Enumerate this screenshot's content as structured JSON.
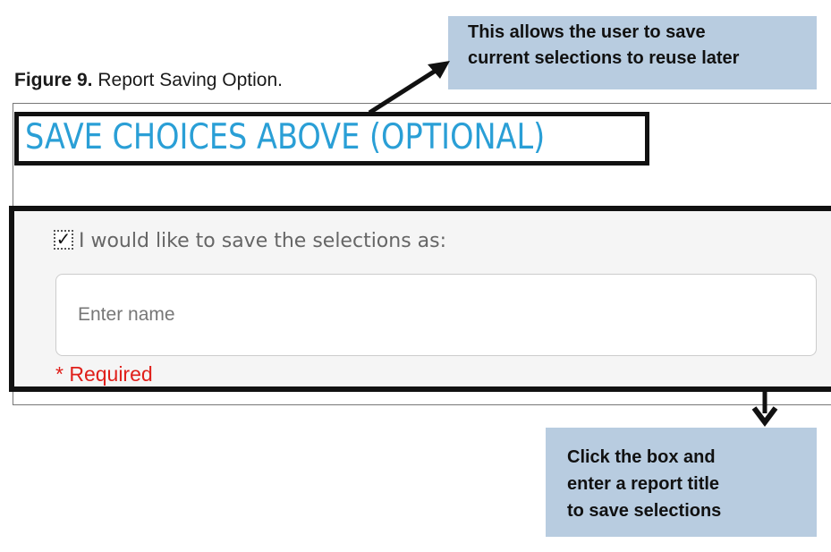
{
  "figure": {
    "label": "Figure 9.",
    "caption": " Report Saving Option."
  },
  "callouts": {
    "top": [
      "This allows the user to save",
      "current selections to reuse later"
    ],
    "bottom": [
      "Click the box and",
      "enter a report title",
      "to save selections"
    ]
  },
  "section": {
    "title": "SAVE CHOICES ABOVE (OPTIONAL)"
  },
  "form": {
    "checkbox_checked": true,
    "checkbox_mark": "✓",
    "checkbox_label": "I would like to save the selections as:",
    "name_placeholder": "Enter name",
    "name_value": "",
    "required_text": "* Required"
  },
  "colors": {
    "title_blue": "#2a9fd6",
    "callout_bg": "#b8cce0",
    "required_red": "#e0201b",
    "outline": "#111111"
  },
  "icons": {
    "checkbox": "checkbox-checked-icon",
    "arrow_up": "arrow-up-right-icon",
    "arrow_down": "arrow-down-icon"
  }
}
